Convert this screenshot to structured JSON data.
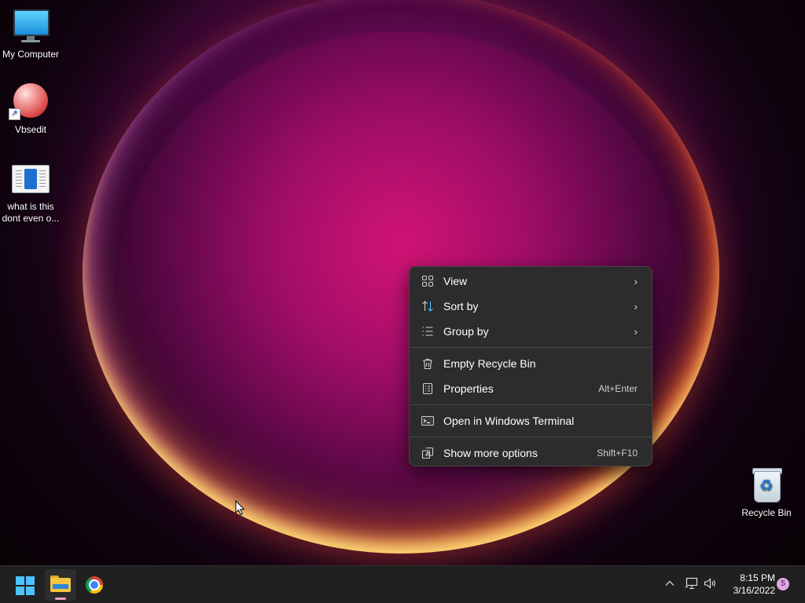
{
  "desktop": {
    "icons": [
      {
        "label": "My Computer",
        "icon": "monitor-icon"
      },
      {
        "label": "Vbsedit",
        "icon": "vbsedit-icon"
      },
      {
        "label_line1": "what is this",
        "label_line2": "dont even o...",
        "icon": "document-icon"
      },
      {
        "label": "Recycle Bin",
        "icon": "recycle-bin-icon"
      }
    ]
  },
  "context_menu": {
    "items": [
      {
        "label": "View",
        "icon": "grid-icon",
        "has_submenu": true
      },
      {
        "label": "Sort by",
        "icon": "sort-icon",
        "has_submenu": true
      },
      {
        "label": "Group by",
        "icon": "list-icon",
        "has_submenu": true
      },
      {
        "label": "Empty Recycle Bin",
        "icon": "trash-icon"
      },
      {
        "label": "Properties",
        "icon": "properties-icon",
        "shortcut": "Alt+Enter"
      },
      {
        "label": "Open in Windows Terminal",
        "icon": "terminal-icon"
      },
      {
        "label": "Show more options",
        "icon": "more-options-icon",
        "shortcut": "Shift+F10"
      }
    ],
    "chevron": "›"
  },
  "taskbar": {
    "apps": [
      {
        "name": "Start",
        "icon": "windows-logo-icon"
      },
      {
        "name": "File Explorer",
        "icon": "folder-icon",
        "active": true
      },
      {
        "name": "Google Chrome",
        "icon": "chrome-icon"
      }
    ],
    "tray": {
      "overflow_glyph": "^",
      "clock_time": "8:15 PM",
      "clock_date": "3/16/2022",
      "notification_count": "5"
    }
  },
  "colors": {
    "menu_bg": "#2c2c2c",
    "taskbar_bg": "#202020",
    "accent": "#4cc2ff"
  }
}
